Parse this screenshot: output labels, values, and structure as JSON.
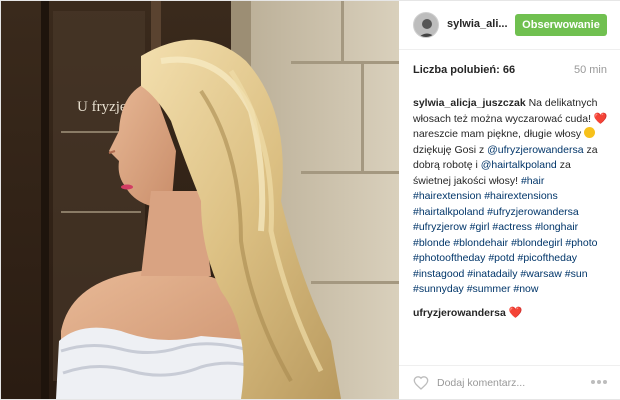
{
  "post": {
    "username": "sylwia_ali...",
    "follow_label": "Obserwowanie",
    "likes_text": "Liczba polubień: 66",
    "time_text": "50 min",
    "photo_sign_text": "U fryzje",
    "caption": {
      "user": "sylwia_alicja_juszczak",
      "text_1": "Na delikatnych włosach też można wyczarować cuda!",
      "text_2": "nareszcie mam piękne, długie włosy",
      "text_3": "dziękuję Gosi z",
      "mention_1": "@ufryzjerowandersa",
      "text_4": "za dobrą robotę i",
      "mention_2": "@hairtalkpoland",
      "text_5": "za świetnej jakości włosy!",
      "hashtags": "#hair #hairextension #hairextensions #hairtalkpoland #ufryzjerowandersa #ufryzjerow #girl #actress #longhair #blonde #blondehair #blondegirl #photo #photooftheday #potd #picoftheday #instagood #inatadaily #warsaw #sun #sunnyday #summer #now"
    },
    "comment_2": {
      "user": "ufryzjerowandersa"
    },
    "comment_placeholder": "Dodaj komentarz...",
    "icons": {
      "heart": "heart-emoji",
      "smile": "smile-emoji",
      "like": "heart-outline-icon",
      "more": "more-dots-icon"
    },
    "colors": {
      "follow_button": "#70c050",
      "hashtag": "#003569",
      "heart": "#ed4956"
    }
  }
}
